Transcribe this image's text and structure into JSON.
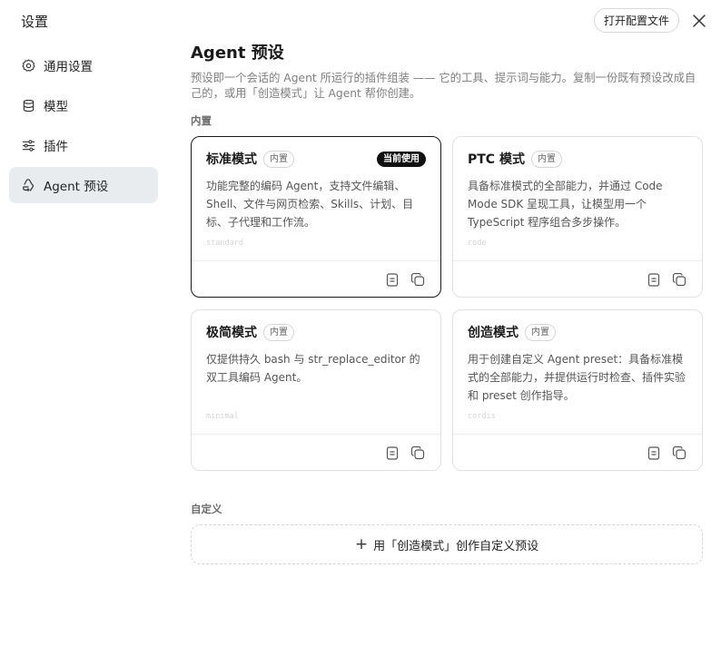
{
  "header": {
    "title": "设置",
    "open_config_label": "打开配置文件"
  },
  "sidebar": {
    "items": [
      {
        "label": "通用设置",
        "icon": "gear-icon",
        "active": false
      },
      {
        "label": "模型",
        "icon": "database-icon",
        "active": false
      },
      {
        "label": "插件",
        "icon": "sliders-icon",
        "active": false
      },
      {
        "label": "Agent 预设",
        "icon": "recycle-icon",
        "active": true
      }
    ]
  },
  "main": {
    "title": "Agent 预设",
    "description": "预设即一个会话的 Agent 所运行的插件组装 —— 它的工具、提示词与能力。复制一份既有预设改成自己的，或用「创造模式」让 Agent 帮你创建。",
    "builtin_label": "内置",
    "custom_label": "自定义",
    "builtin_badge": "内置",
    "current_badge": "当前使用",
    "presets": [
      {
        "title": "标准模式",
        "current": true,
        "desc": "功能完整的编码 Agent，支持文件编辑、Shell、文件与网页检索、Skills、计划、目标、子代理和工作流。",
        "id": "standard"
      },
      {
        "title": "PTC 模式",
        "current": false,
        "desc": "具备标准模式的全部能力，并通过 Code Mode SDK 呈现工具，让模型用一个 TypeScript 程序组合多步操作。",
        "id": "code"
      },
      {
        "title": "极简模式",
        "current": false,
        "desc": "仅提供持久 bash 与 str_replace_editor 的双工具编码 Agent。",
        "id": "minimal"
      },
      {
        "title": "创造模式",
        "current": false,
        "desc": "用于创建自定义 Agent preset：具备标准模式的全部能力，并提供运行时检查、插件实验和 preset 创作指导。",
        "id": "cordis"
      }
    ],
    "create_button_label": "用「创造模式」创作自定义预设"
  }
}
